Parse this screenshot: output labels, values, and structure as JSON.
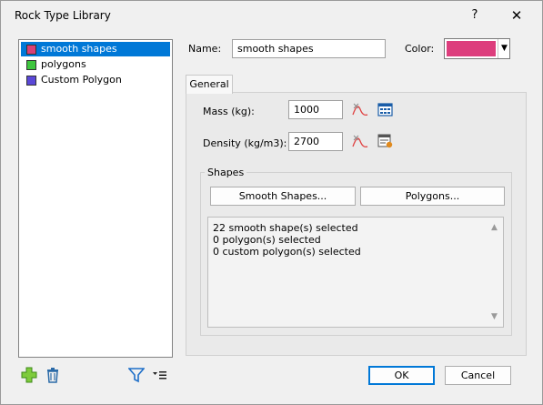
{
  "window": {
    "title": "Rock Type Library",
    "help_label": "?",
    "close_label": "✕"
  },
  "rock_list": {
    "items": [
      {
        "label": "smooth shapes",
        "color": "#d94076",
        "selected": true
      },
      {
        "label": "polygons",
        "color": "#3ec63e",
        "selected": false
      },
      {
        "label": "Custom Polygon",
        "color": "#5a48d8",
        "selected": false
      }
    ]
  },
  "toolbar": {
    "add_icon": "add-icon",
    "delete_icon": "trash-icon",
    "filter_icon": "filter-icon",
    "options_icon": "list-options-icon"
  },
  "properties": {
    "name_label": "Name:",
    "name_value": "smooth shapes",
    "color_label": "Color:",
    "color_value": "#dd3e7d"
  },
  "tabs": [
    {
      "label": "General",
      "active": true
    }
  ],
  "general": {
    "mass_label": "Mass (kg):",
    "mass_value": "1000",
    "density_label": "Density (kg/m3):",
    "density_value": "2700"
  },
  "shapes": {
    "group_label": "Shapes",
    "smooth_button": "Smooth Shapes...",
    "polygons_button": "Polygons...",
    "summary": [
      "22 smooth shape(s) selected",
      "0 polygon(s) selected",
      "0 custom polygon(s) selected"
    ]
  },
  "footer": {
    "ok_label": "OK",
    "cancel_label": "Cancel"
  }
}
